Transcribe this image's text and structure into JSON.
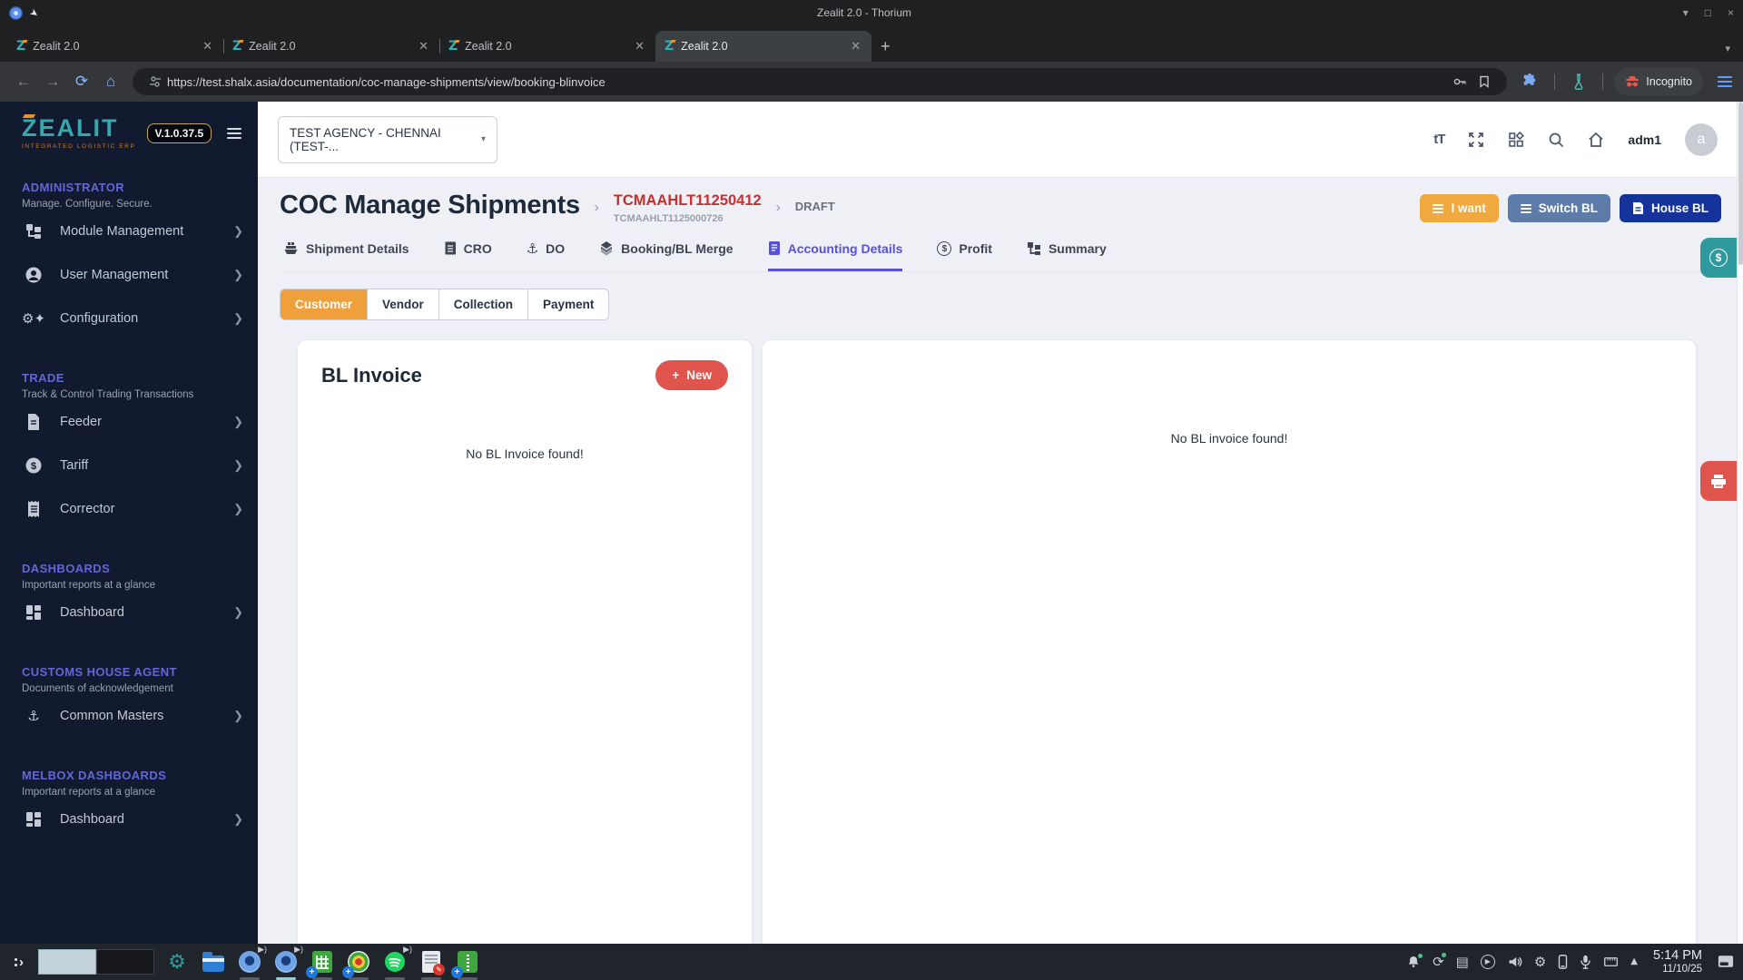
{
  "browser": {
    "window_title": "Zealit 2.0 - Thorium",
    "tabs": [
      {
        "label": "Zealit 2.0"
      },
      {
        "label": "Zealit 2.0"
      },
      {
        "label": "Zealit 2.0"
      },
      {
        "label": "Zealit 2.0"
      }
    ],
    "active_tab_index": 3,
    "url": "https://test.shalx.asia/documentation/coc-manage-shipments/view/booking-blinvoice",
    "incognito_label": "Incognito"
  },
  "sidebar": {
    "logo": "ZEALIT",
    "logo_sub": "INTEGRATED LOGISTIC ERP",
    "version": "V.1.0.37.5",
    "sections": [
      {
        "title": "ADMINISTRATOR",
        "subtitle": "Manage. Configure. Secure.",
        "items": [
          {
            "label": "Module Management",
            "icon": "module-icon"
          },
          {
            "label": "User Management",
            "icon": "user-icon"
          },
          {
            "label": "Configuration",
            "icon": "gear-icon"
          }
        ]
      },
      {
        "title": "TRADE",
        "subtitle": "Track & Control Trading Transactions",
        "items": [
          {
            "label": "Feeder",
            "icon": "document-icon"
          },
          {
            "label": "Tariff",
            "icon": "dollar-icon"
          },
          {
            "label": "Corrector",
            "icon": "receipt-icon"
          }
        ]
      },
      {
        "title": "DASHBOARDS",
        "subtitle": "Important reports at a glance",
        "items": [
          {
            "label": "Dashboard",
            "icon": "grid-icon"
          }
        ]
      },
      {
        "title": "CUSTOMS HOUSE AGENT",
        "subtitle": "Documents of acknowledgement",
        "items": [
          {
            "label": "Common Masters",
            "icon": "anchor-icon"
          }
        ]
      },
      {
        "title": "MELBOX DASHBOARDS",
        "subtitle": "Important reports at a glance",
        "items": [
          {
            "label": "Dashboard",
            "icon": "grid-icon"
          }
        ]
      }
    ]
  },
  "topbar": {
    "agency_select": "TEST AGENCY - CHENNAI  (TEST-...",
    "username": "adm1",
    "avatar_letter": "a"
  },
  "page": {
    "title": "COC Manage Shipments",
    "ref": "TCMAAHLT11250412",
    "ref_sub": "TCMAAHLT1125000726",
    "status": "DRAFT",
    "actions": {
      "i_want": "I want",
      "switch_bl": "Switch BL",
      "house_bl": "House BL"
    },
    "tabs": [
      {
        "label": "Shipment Details",
        "icon": "ship-icon"
      },
      {
        "label": "CRO",
        "icon": "receipt-icon"
      },
      {
        "label": "DO",
        "icon": "anchor-icon"
      },
      {
        "label": "Booking/BL Merge",
        "icon": "layers-icon"
      },
      {
        "label": "Accounting Details",
        "icon": "invoice-icon"
      },
      {
        "label": "Profit",
        "icon": "dollar-icon"
      },
      {
        "label": "Summary",
        "icon": "flow-icon"
      }
    ],
    "active_tab": "Accounting Details",
    "subtabs": [
      {
        "label": "Customer"
      },
      {
        "label": "Vendor"
      },
      {
        "label": "Collection"
      },
      {
        "label": "Payment"
      }
    ],
    "active_subtab": "Customer",
    "panel": {
      "title": "BL Invoice",
      "new_label": "New",
      "empty_left": "No BL Invoice found!",
      "empty_right": "No BL invoice found!"
    }
  },
  "taskbar": {
    "time": "5:14 PM",
    "date": "11/10/25"
  },
  "colors": {
    "accent_orange": "#F0A93F",
    "accent_red": "#E0544E",
    "navy_button": "#16339B",
    "slate_button": "#5E7CA9",
    "teal_float": "#2E9A9D",
    "active_tab_indigo": "#5651D9",
    "brand_teal": "#35A7AD",
    "brand_orange": "#E8922E",
    "ref_red": "#C53030",
    "sidebar_bg": "#111A2E"
  }
}
